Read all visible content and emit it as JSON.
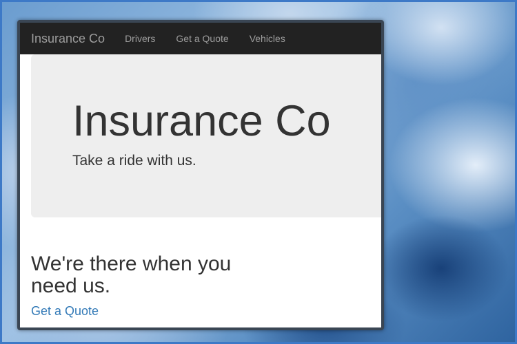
{
  "navbar": {
    "brand": "Insurance Co",
    "links": [
      "Drivers",
      "Get a Quote",
      "Vehicles"
    ]
  },
  "jumbotron": {
    "title": "Insurance Co",
    "tagline": "Take a ride with us."
  },
  "main": {
    "heading": "We're there when you need us.",
    "link_label": "Get a Quote"
  },
  "colors": {
    "navbar_bg": "#222222",
    "navbar_text": "#9d9d9d",
    "jumbotron_bg": "#eeeeee",
    "link": "#337ab7",
    "text": "#333333"
  }
}
